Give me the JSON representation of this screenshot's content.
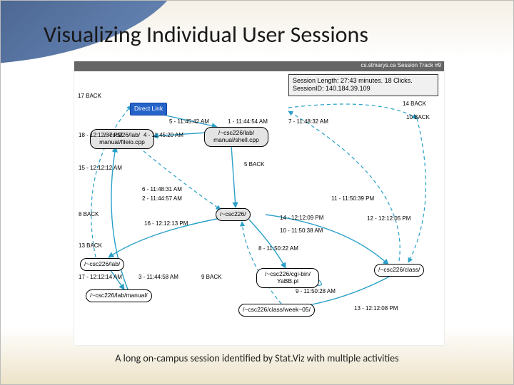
{
  "slide": {
    "title": "Visualizing Individual User Sessions",
    "caption": "A long on-campus session identified by Stat.Viz with multiple activities"
  },
  "diagram": {
    "header_strip": "cs.stmarys.ca Session Track #9",
    "session_info": {
      "line1": "Session Length: 27:43 minutes. 18 Clicks.",
      "line2": "SessionID: 140.184.39.109"
    },
    "entry_label": "Direct Link",
    "nodes": {
      "fileio": "/~csc226/lab/\nmanual/fileio.cpp",
      "shell": "/~csc226/lab/\nmanual/shell.cpp",
      "csc226": "/~csc226/",
      "lab": "/~csc226/lab/",
      "labmanual": "/~csc226/lab/manual/",
      "cgibin": "/~csc226/cgi-bin/\nYaBB.pl",
      "classtop": "/~csc226/class/",
      "classweek": "/~csc226/class/week~05/"
    },
    "edge_labels": {
      "e1": "1 - 11:44:54 AM",
      "e2": "2 - 11:44:57 AM",
      "e3": "3 - 11:44:58 AM",
      "e4": "4 - 11:45:20 AM",
      "e5": "5 - 11:45:42 AM",
      "e6": "6 - 11:48:31 AM",
      "e7": "7 - 11:48:32 AM",
      "e8": "8 - 11:50:22 AM",
      "e9": "9 - 11:50:28 AM",
      "e10": "10 - 11:50:38 AM",
      "e11": "11 - 11:50:39 PM",
      "e12": "12 - 12:12:05 PM",
      "e13": "13 - 12:12:08 PM",
      "e14": "14 - 12:12:09 PM",
      "e15": "15 - 12:12:12 AM",
      "e16": "16 - 12:12:13 PM",
      "e17": "17 - 12:12:14 AM",
      "e18": "18 - 12:12:37 PM",
      "back5": "5 BACK",
      "back17t": "17 BACK",
      "back14t": "14 BACK",
      "back10r": "10 BACK",
      "back8l": "8 BACK",
      "back13l": "13 BACK",
      "back9": "9 BACK"
    }
  }
}
